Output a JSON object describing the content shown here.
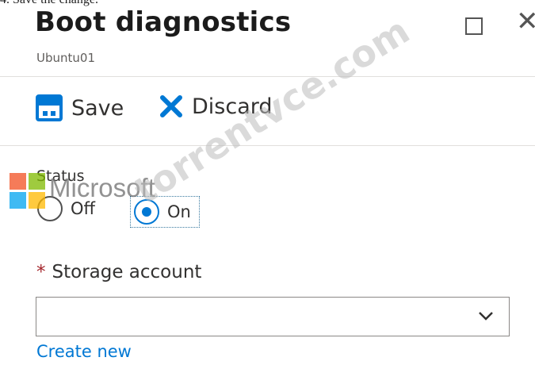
{
  "top_clipped_text": "4. Save the change.",
  "blade": {
    "title": "Boot diagnostics",
    "subtitle": "Ubuntu01"
  },
  "toolbar": {
    "save_label": "Save",
    "discard_label": "Discard"
  },
  "status": {
    "label": "Status",
    "options": [
      {
        "label": "Off",
        "selected": false
      },
      {
        "label": "On",
        "selected": true
      }
    ]
  },
  "storage_account": {
    "required_marker": "*",
    "label": "Storage account",
    "value": ""
  },
  "create_new_link": "Create new",
  "overlay": {
    "microsoft_text": "Microsoft",
    "watermark_text": "torrentvce.com"
  },
  "colors": {
    "accent": "#0078d4",
    "required": "#a4262c",
    "logo": [
      "#f25022",
      "#7fba00",
      "#00a4ef",
      "#ffb900"
    ]
  }
}
